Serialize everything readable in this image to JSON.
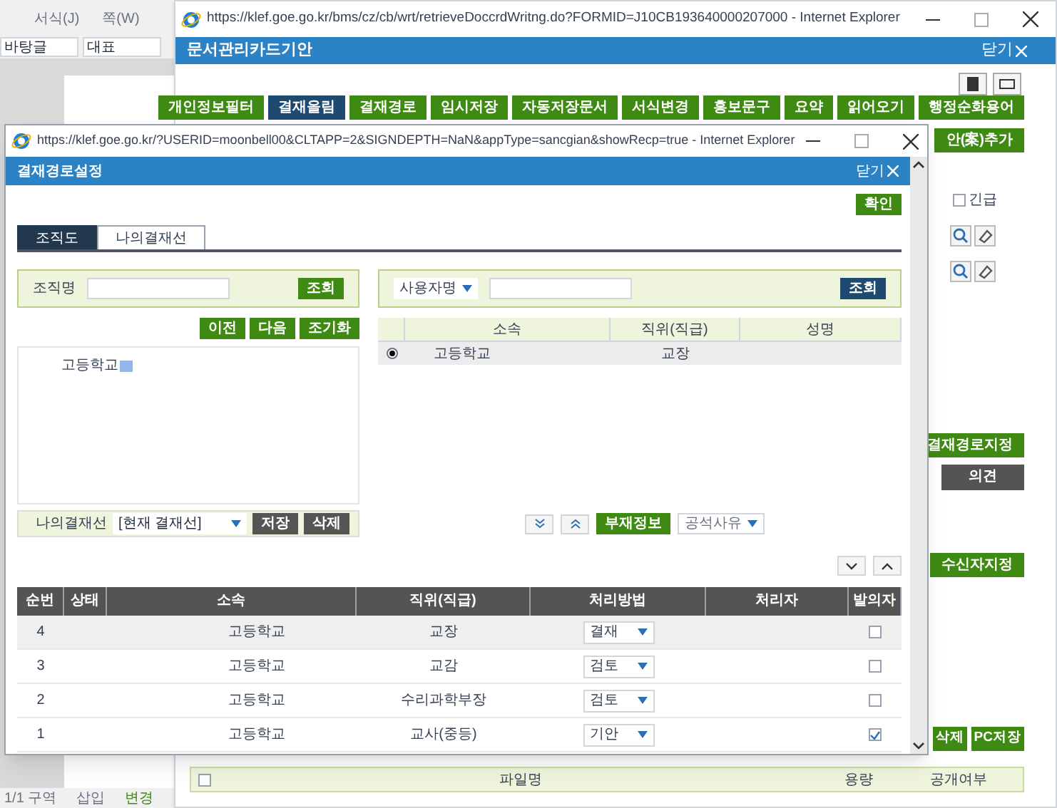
{
  "editor": {
    "menu": [
      "서식(J)",
      "쪽(W)"
    ],
    "style_fields": [
      "바탕글",
      "대표"
    ],
    "status_bar": [
      "1/1 구역",
      "삽입",
      "변경"
    ]
  },
  "back_window": {
    "title": "https://klef.goe.go.kr/bms/cz/cb/wrt/retrieveDoccrdWritng.do?FORMID=J10CB193640000207000 - Internet Explorer",
    "header": "문서관리카드기안",
    "close": "닫기",
    "toolbar": [
      {
        "label": "개인정보필터",
        "kind": "action"
      },
      {
        "label": "결재올림",
        "kind": "primary"
      },
      {
        "label": "결재경로",
        "kind": "action"
      },
      {
        "label": "임시저장",
        "kind": "action"
      },
      {
        "label": "자동저장문서",
        "kind": "action"
      },
      {
        "label": "서식변경",
        "kind": "action"
      },
      {
        "label": "홍보문구",
        "kind": "action"
      },
      {
        "label": "요약",
        "kind": "action"
      },
      {
        "label": "읽어오기",
        "kind": "action"
      },
      {
        "label": "행정순화용어",
        "kind": "action"
      }
    ],
    "add_button": "안(案)추가",
    "urgent": {
      "label": "긴급",
      "checked": false
    },
    "route_button": "결재경로지정",
    "opinion_header": "의견",
    "recipient_button": "수신자지정",
    "bottom_buttons": [
      "삭제",
      "PC저장"
    ],
    "file_table": {
      "checked": false,
      "columns": [
        "파일명",
        "용량",
        "공개여부"
      ]
    }
  },
  "front_window": {
    "title": "https://klef.goe.go.kr/?USERID=moonbell00&CLTAPP=2&SIGNDEPTH=NaN&appType=sancgian&showRecp=true - Internet Explorer",
    "header": "결재경로설정",
    "close": "닫기",
    "confirm": "확인",
    "tabs": [
      {
        "label": "조직도",
        "selected": true
      },
      {
        "label": "나의결재선",
        "selected": false
      }
    ],
    "org_search": {
      "label": "조직명",
      "button": "조회"
    },
    "nav_buttons": [
      "이전",
      "다음",
      "조기화"
    ],
    "tree": [
      {
        "label": "고등학교"
      }
    ],
    "my_line": {
      "label": "나의결재선",
      "value": "[현재 결재선]",
      "buttons": [
        "저장",
        "삭제"
      ]
    },
    "user_search": {
      "select": "사용자명",
      "button": "조회"
    },
    "users_table": {
      "columns": [
        "소속",
        "직위(직급)",
        "성명"
      ],
      "rows": [
        {
          "selected": true,
          "affiliation": "고등학교",
          "position": "교장"
        }
      ]
    },
    "absence_button": "부재정보",
    "vacancy_select": "공석사유",
    "route_table": {
      "columns": [
        "순번",
        "상태",
        "소속",
        "직위(직급)",
        "처리방법",
        "처리자",
        "발의자"
      ],
      "rows": [
        {
          "number": "4",
          "affiliation": "고등학교",
          "position": "교장",
          "method": "결재",
          "initiator": false
        },
        {
          "number": "3",
          "affiliation": "고등학교",
          "position": "교감",
          "method": "검토",
          "initiator": false
        },
        {
          "number": "2",
          "affiliation": "고등학교",
          "position": "수리과학부장",
          "method": "검토",
          "initiator": false
        },
        {
          "number": "1",
          "affiliation": "고등학교",
          "position": "교사(중등)",
          "method": "기안",
          "initiator": true
        }
      ]
    }
  }
}
